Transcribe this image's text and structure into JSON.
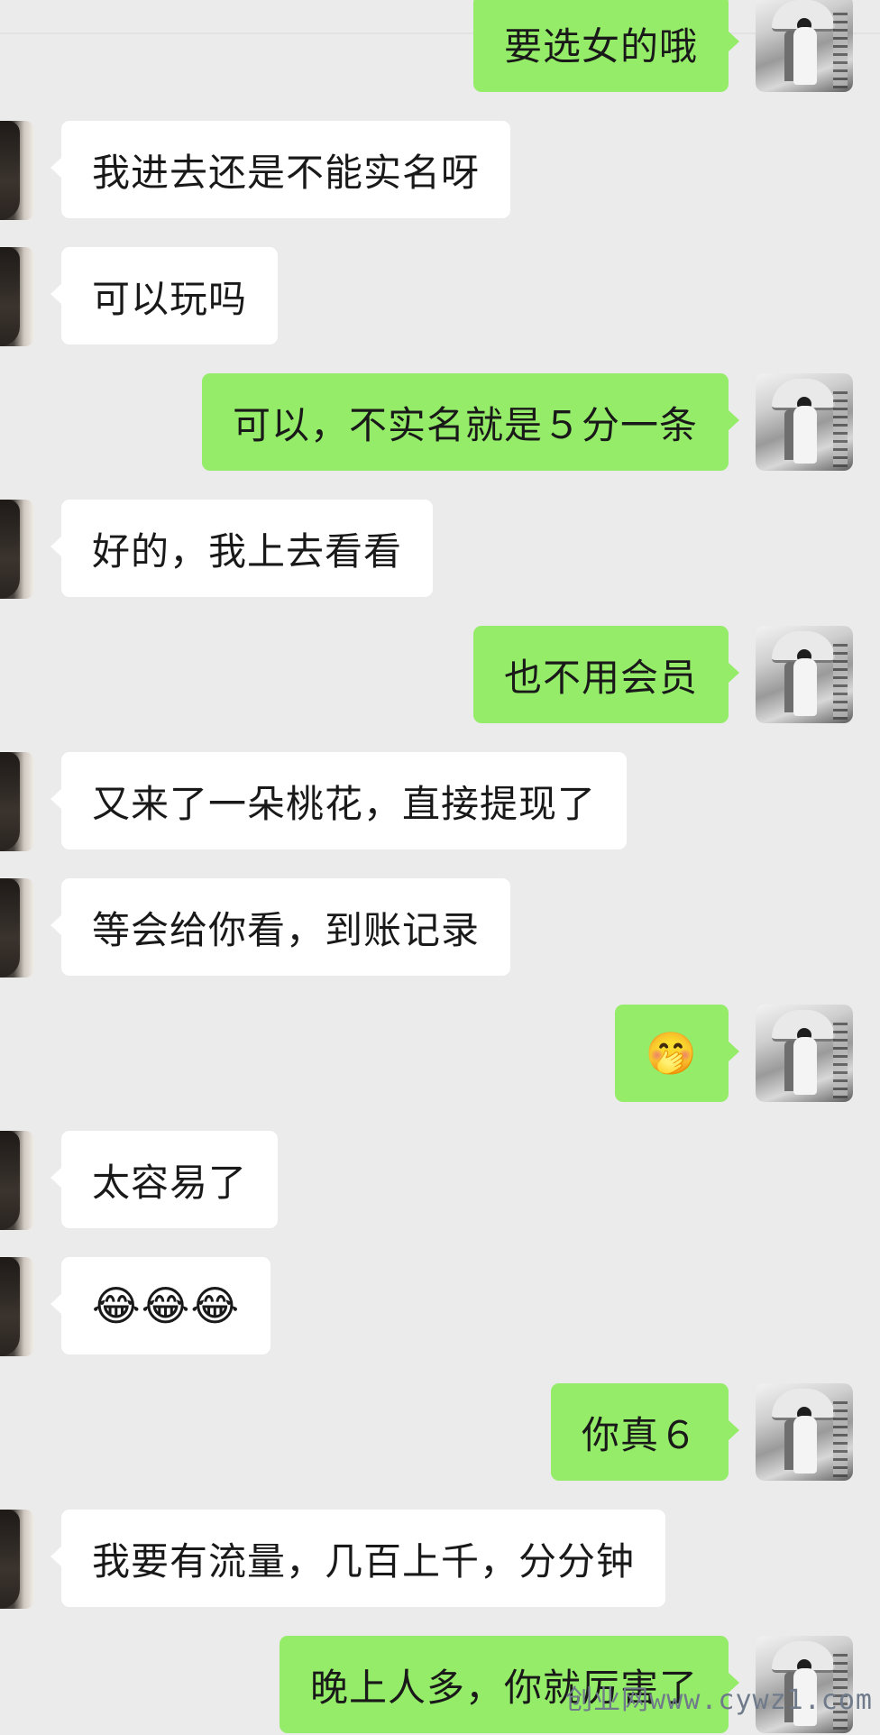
{
  "colors": {
    "background": "#ebebeb",
    "incoming_bubble": "#ffffff",
    "outgoing_bubble": "#95ec69",
    "text": "#191919"
  },
  "messages": [
    {
      "side": "out",
      "text": "要选女的哦"
    },
    {
      "side": "in",
      "text": "我进去还是不能实名呀"
    },
    {
      "side": "in",
      "text": "可以玩吗"
    },
    {
      "side": "out",
      "text": "可以，不实名就是５分一条"
    },
    {
      "side": "in",
      "text": "好的，我上去看看"
    },
    {
      "side": "out",
      "text": "也不用会员"
    },
    {
      "side": "in",
      "text": "又来了一朵桃花，直接提现了"
    },
    {
      "side": "in",
      "text": "等会给你看，到账记录"
    },
    {
      "side": "out",
      "text": "🤭"
    },
    {
      "side": "in",
      "text": "太容易了"
    },
    {
      "side": "in",
      "text": "😂😂😂"
    },
    {
      "side": "out",
      "text": "你真６"
    },
    {
      "side": "in",
      "text": "我要有流量，几百上千，分分钟"
    },
    {
      "side": "out",
      "text": "晚上人多，你就厉害了"
    }
  ],
  "watermark": "创业网www.cywz1.com"
}
